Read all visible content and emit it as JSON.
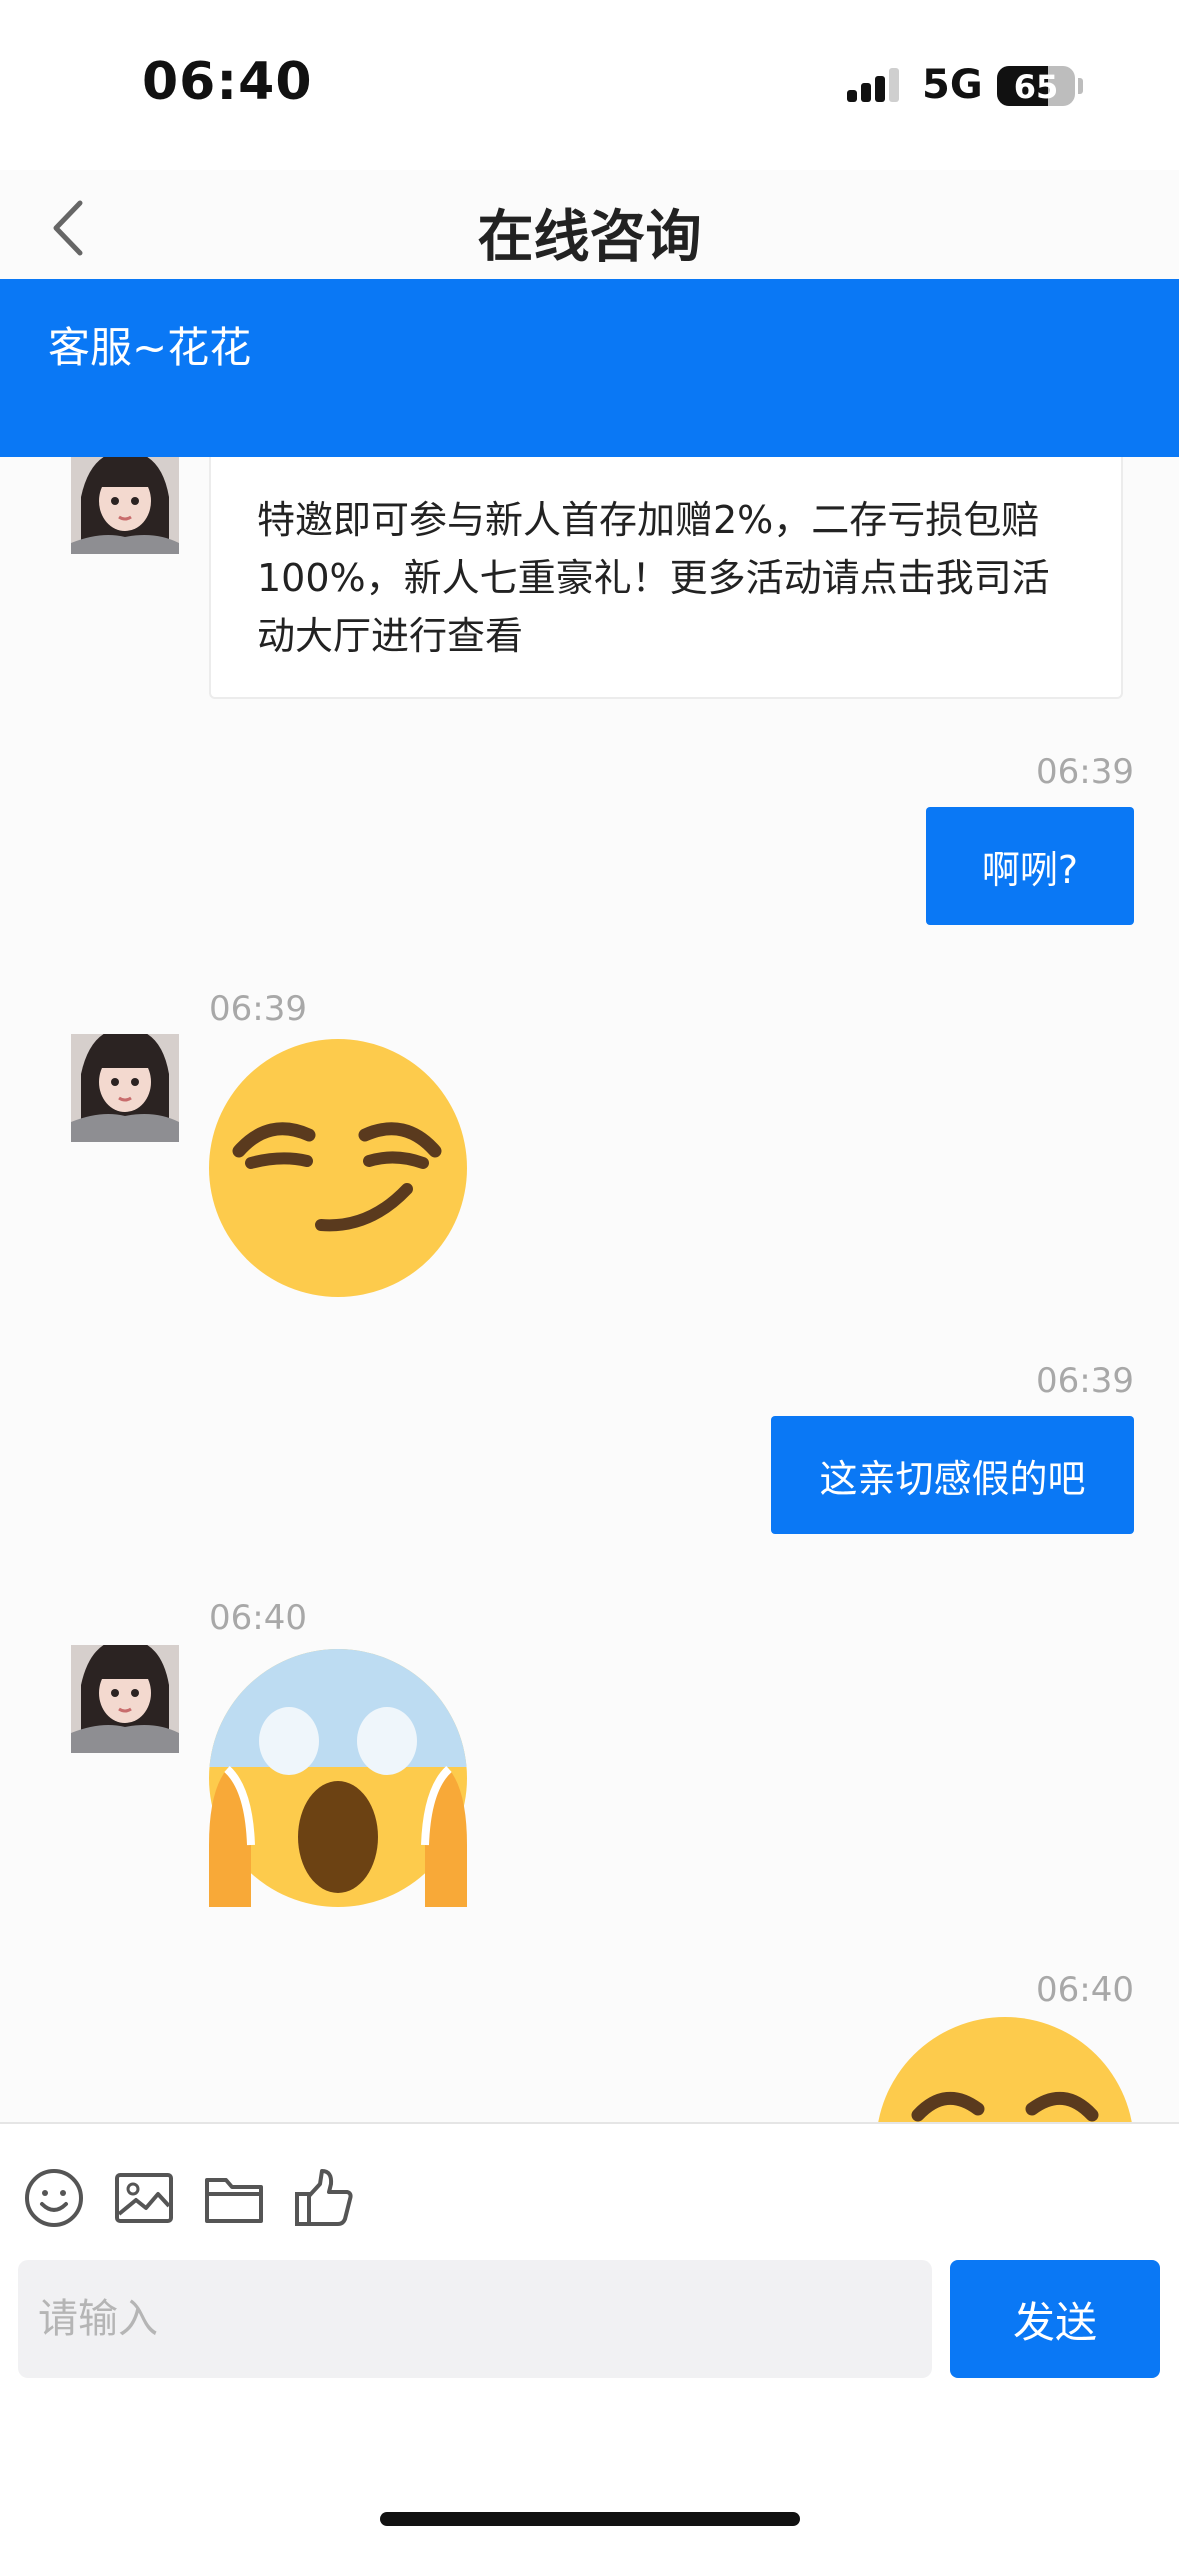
{
  "status_bar": {
    "time": "06:40",
    "network": "5G",
    "battery_level": "65"
  },
  "nav": {
    "title": "在线咨询",
    "back_icon": "chevron-left-icon"
  },
  "agent": {
    "name": "客服~花花"
  },
  "messages": [
    {
      "side": "left",
      "type": "text",
      "text": "特邀即可参与新人首存加赠2%，二存亏损包赔100%，新人七重豪礼！更多活动请点击我司活动大厅进行查看",
      "lines": [
        "特邀即可参与新人首存加赠2%，二存亏损包赔",
        "100%，新人七重豪礼！更多活动请点击我司活",
        "动大厅进行查看"
      ]
    },
    {
      "side": "right",
      "type": "text",
      "time": "06:39",
      "text": "啊咧?"
    },
    {
      "side": "left",
      "type": "emoji",
      "time": "06:39",
      "emoji": "smirking-face"
    },
    {
      "side": "right",
      "type": "text",
      "time": "06:39",
      "text": "这亲切感假的吧"
    },
    {
      "side": "left",
      "type": "emoji",
      "time": "06:40",
      "emoji": "face-screaming-in-fear"
    },
    {
      "side": "right",
      "type": "emoji",
      "time": "06:40",
      "emoji": "smiling-face-partially-visible"
    }
  ],
  "composer": {
    "tools": [
      "smile-icon",
      "image-icon",
      "folder-icon",
      "thumbs-up-icon"
    ],
    "placeholder": "请输入",
    "send_label": "发送"
  },
  "colors": {
    "accent": "#0a78f5",
    "emoji_yellow": "#fdcb4c",
    "background": "#fbfbfb"
  }
}
